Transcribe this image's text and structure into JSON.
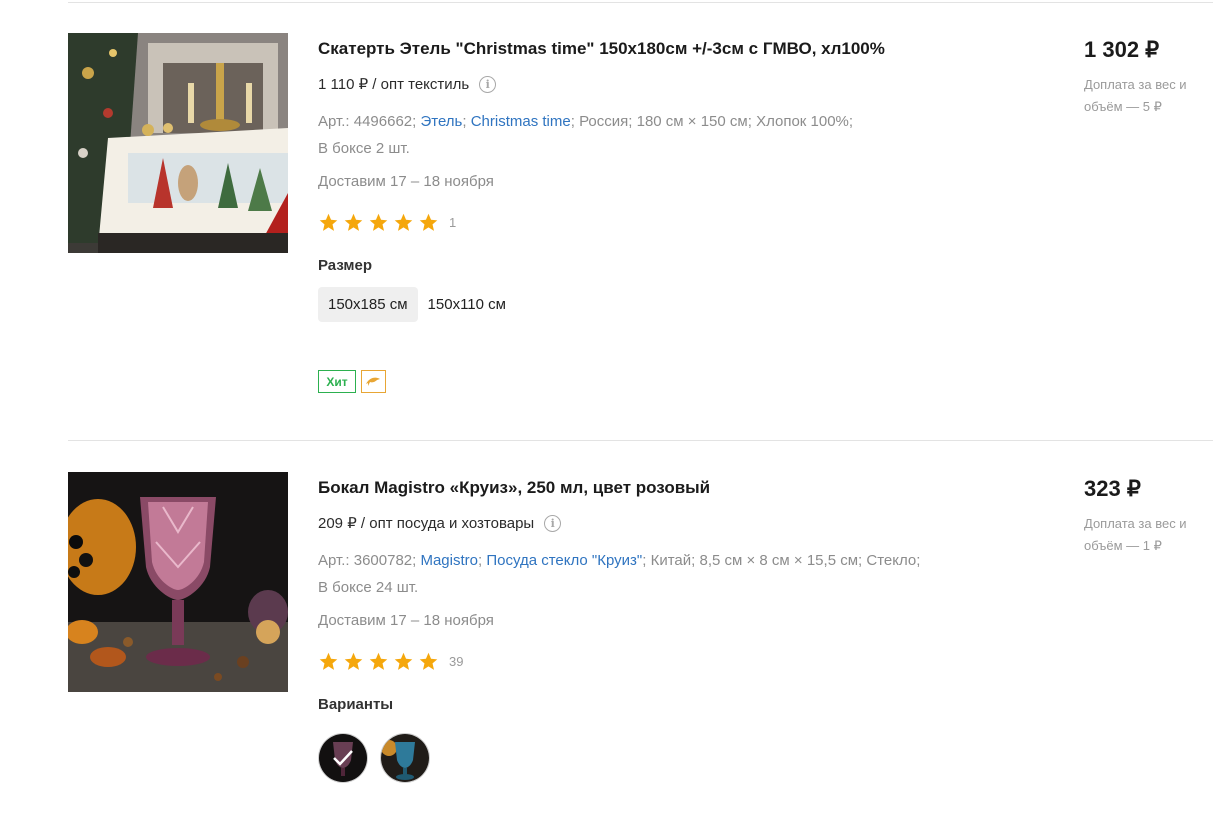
{
  "products": [
    {
      "title": "Скатерть Этель \"Christmas time\" 150х180см +/-3см с ГМВО, хл100%",
      "wholesale": "1 110 ₽ / опт текстиль",
      "art": "Арт.: 4496662;",
      "brand": "Этель",
      "series": "Christmas time",
      "country": "Россия;",
      "dims": "180 см × 150 см;",
      "material": "Хлопок 100%;",
      "box": "В боксе 2 шт.",
      "delivery": "Доставим 17 – 18 ноября",
      "rating": 5,
      "reviews": "1",
      "option_label": "Размер",
      "sizes": [
        "150х185 см",
        "150х110 см"
      ],
      "badge_hit": "Хит",
      "price": "1 302 ₽",
      "surcharge": "Доплата за вес и объём — 5 ₽",
      "image": "tablecloth-christmas-photo"
    },
    {
      "title": "Бокал Magistro «Круиз», 250 мл, цвет розовый",
      "wholesale": "209 ₽ / опт посуда и хозтовары",
      "art": "Арт.: 3600782;",
      "brand": "Magistro",
      "series": "Посуда стекло \"Круиз\"",
      "country": "Китай;",
      "dims": "8,5 см × 8 см × 15,5 см;",
      "material": "Стекло;",
      "box": "В боксе 24 шт.",
      "delivery": "Доставим 17 – 18 ноября",
      "rating": 5,
      "reviews": "39",
      "option_label": "Варианты",
      "variants": [
        "pink-glass-variant",
        "blue-glass-variant"
      ],
      "price": "323 ₽",
      "surcharge": "Доплата за вес и объём — 1 ₽",
      "image": "pink-goblet-photo"
    }
  ],
  "colors": {
    "link": "#2f74c0",
    "star": "#f5a70c",
    "hit": "#2cb04f",
    "muted": "#8c8c8c"
  }
}
